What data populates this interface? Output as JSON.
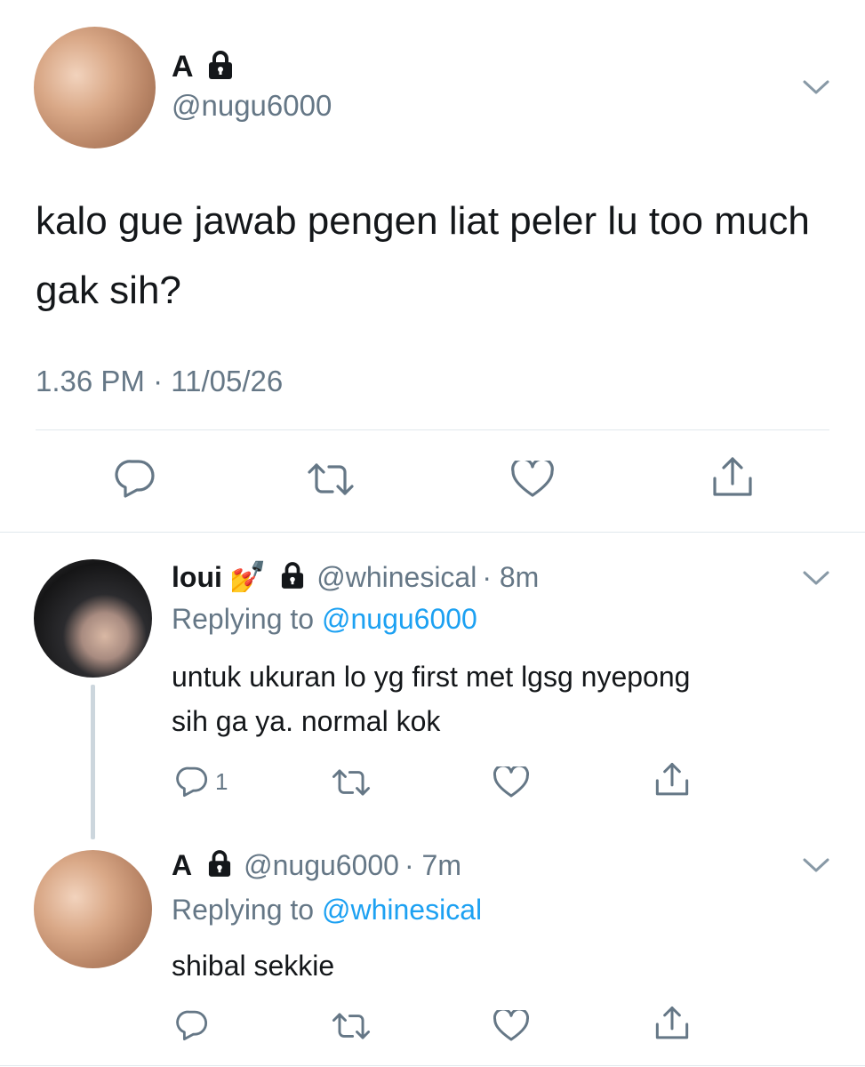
{
  "main_tweet": {
    "display_name": "A",
    "handle": "@nugu6000",
    "text": "kalo gue jawab pengen liat peler lu too much gak sih?",
    "timestamp": "1.36 PM · 11/05/26",
    "protected_icon": "lock-icon",
    "actions": [
      "reply-icon",
      "retweet-icon",
      "like-icon",
      "share-icon"
    ]
  },
  "replies": [
    {
      "display_name": "loui",
      "emoji": "💅",
      "handle": "@whinesical",
      "time": "· 8m",
      "replying_prefix": "Replying to",
      "replying_to": "@nugu6000",
      "text_line1": "untuk ukuran lo yg first met lgsg nyepong",
      "text_line2": "sih ga ya. normal kok",
      "reply_count": "1"
    },
    {
      "display_name": "A",
      "handle": "@nugu6000",
      "time": "· 7m",
      "replying_prefix": "Replying to",
      "replying_to": "@whinesical",
      "text": "shibal sekkie",
      "reply_count": ""
    }
  ],
  "colors": {
    "text": "#14171a",
    "secondary": "#657786",
    "link": "#1da1f2",
    "divider": "#e1e8ed"
  }
}
